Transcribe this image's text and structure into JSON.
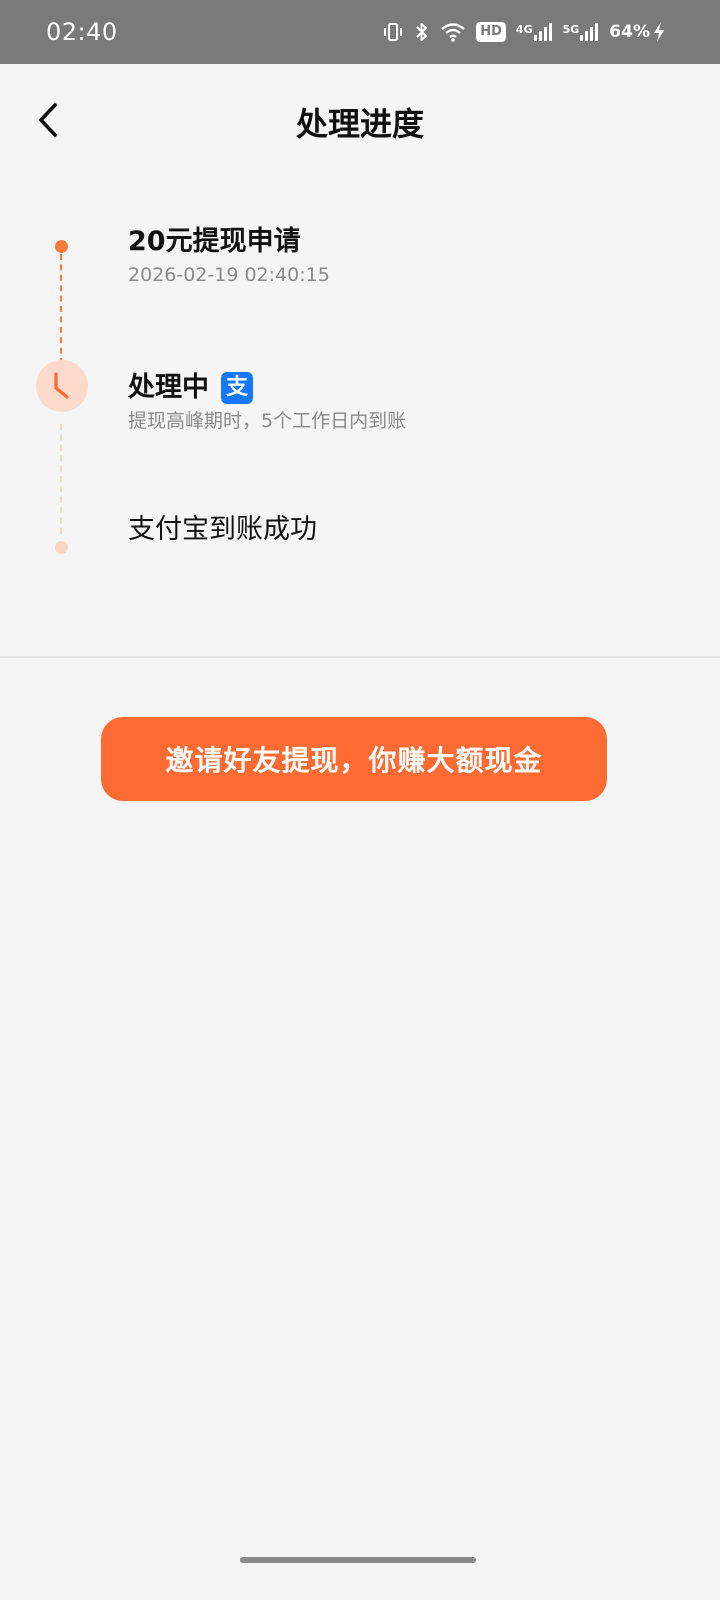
{
  "status_bar": {
    "time": "02:40",
    "hd_label": "HD",
    "net1_label": "4G",
    "net2_label": "5G",
    "battery": "64%"
  },
  "header": {
    "title": "处理进度"
  },
  "timeline": {
    "steps": [
      {
        "title": "20元提现申请",
        "subtitle": "2026-02-19 02:40:15",
        "state": "done"
      },
      {
        "title": "处理中",
        "subtitle": "提现高峰期时，5个工作日内到账",
        "state": "in-progress",
        "badge_icon": "alipay-icon",
        "badge_text": "支"
      },
      {
        "title": "支付宝到账成功",
        "state": "pending"
      }
    ]
  },
  "invite_button": {
    "label": "邀请好友提现，你赚大额现金"
  },
  "colors": {
    "accent": "#ff6b32",
    "accent_light": "#fcd5c2",
    "alipay_blue": "#1677ff",
    "background": "#f5f5f5"
  }
}
